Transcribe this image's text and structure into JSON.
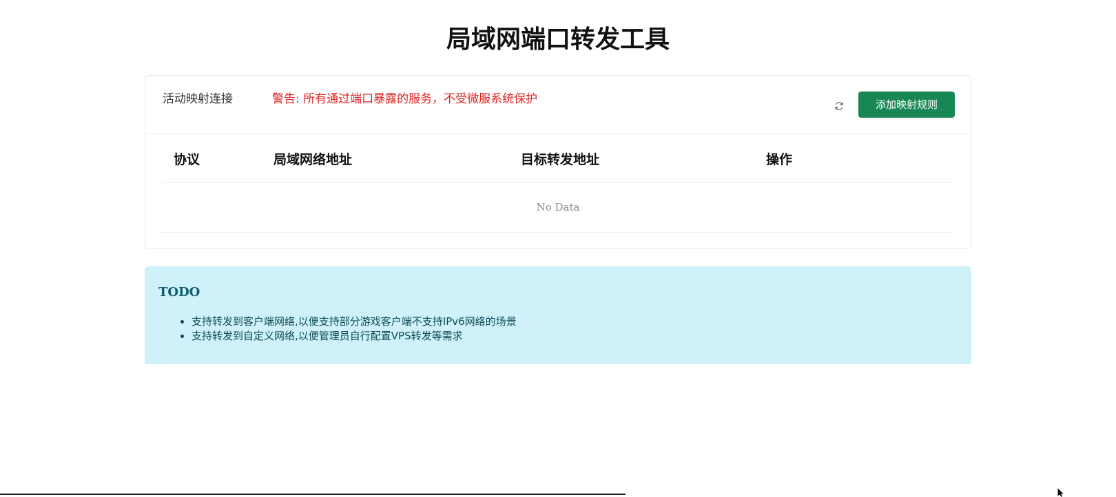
{
  "page": {
    "title": "局域网端口转发工具"
  },
  "mapping_card": {
    "title": "活动映射连接",
    "warning": "警告: 所有通过端口暴露的服务，不受微服系统保护",
    "refresh_icon": "refresh-icon",
    "add_button_label": "添加映射规则",
    "table": {
      "columns": [
        "协议",
        "局域网络地址",
        "目标转发地址",
        "操作"
      ],
      "rows": [],
      "empty_text": "No Data"
    }
  },
  "todo": {
    "title": "TODO",
    "items": [
      "支持转发到客户端网络,以便支持部分游戏客户端不支持IPv6网络的场景",
      "支持转发到自定义网络,以便管理员自行配置VPS转发等需求"
    ]
  },
  "colors": {
    "primary_button": "#198754",
    "warning_text": "#e02424",
    "info_background": "#cff1f9",
    "info_text": "#0c5d6e"
  }
}
